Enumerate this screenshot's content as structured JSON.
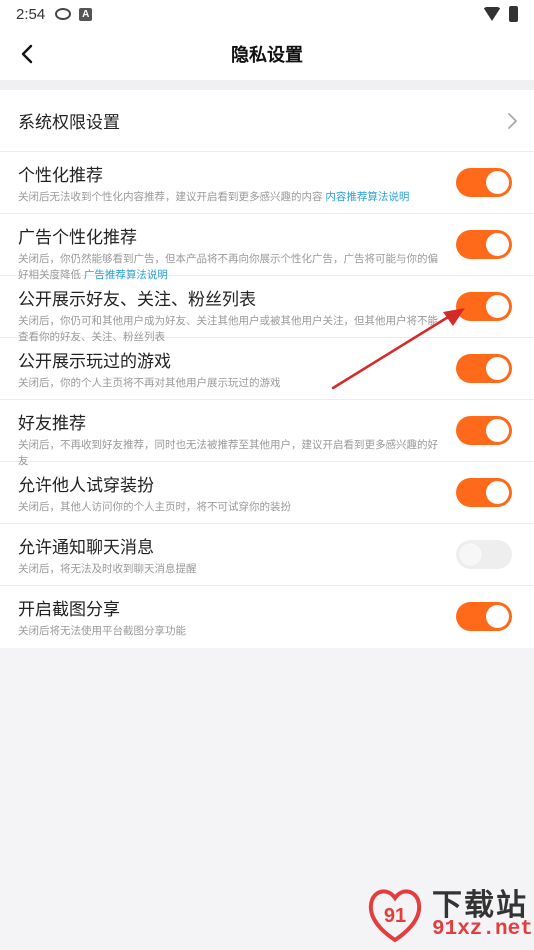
{
  "status_bar": {
    "time": "2:54",
    "icons": [
      "weibo-icon",
      "app-a-icon",
      "wifi-icon",
      "battery-icon"
    ]
  },
  "header": {
    "title": "隐私设置",
    "back_icon": "back-arrow-icon"
  },
  "system_permission": {
    "label": "系统权限设置",
    "icon": "chevron-right-icon"
  },
  "settings": [
    {
      "title": "个性化推荐",
      "desc": "关闭后无法收到个性化内容推荐，建议开启看到更多感兴趣的内容",
      "link": "内容推荐算法说明",
      "enabled": true
    },
    {
      "title": "广告个性化推荐",
      "desc": "关闭后，你仍然能够看到广告，但本产品将不再向你展示个性化广告，广告将可能与你的偏好相关度降低",
      "link": "广告推荐算法说明",
      "enabled": true
    },
    {
      "title": "公开展示好友、关注、粉丝列表",
      "desc": "关闭后，你仍可和其他用户成为好友、关注其他用户或被其他用户关注，但其他用户将不能查看你的好友、关注、粉丝列表",
      "link": "",
      "enabled": true
    },
    {
      "title": "公开展示玩过的游戏",
      "desc": "关闭后，你的个人主页将不再对其他用户展示玩过的游戏",
      "link": "",
      "enabled": true
    },
    {
      "title": "好友推荐",
      "desc": "关闭后，不再收到好友推荐，同时也无法被推荐至其他用户，建议开启看到更多感兴趣的好友",
      "link": "",
      "enabled": true
    },
    {
      "title": "允许他人试穿装扮",
      "desc": "关闭后，其他人访问你的个人主页时，将不可试穿你的装扮",
      "link": "",
      "enabled": true
    },
    {
      "title": "允许通知聊天消息",
      "desc": "关闭后，将无法及时收到聊天消息提醒",
      "link": "",
      "enabled": false
    },
    {
      "title": "开启截图分享",
      "desc": "关闭后将无法使用平台截图分享功能",
      "link": "",
      "enabled": true
    }
  ],
  "colors": {
    "toggle_on": "#ff6a1a",
    "toggle_off": "#eeeeee",
    "link": "#2aa1d6",
    "annotation_arrow": "#d42a2a"
  },
  "watermark": {
    "title": "下载站",
    "url": "91xz.net"
  }
}
